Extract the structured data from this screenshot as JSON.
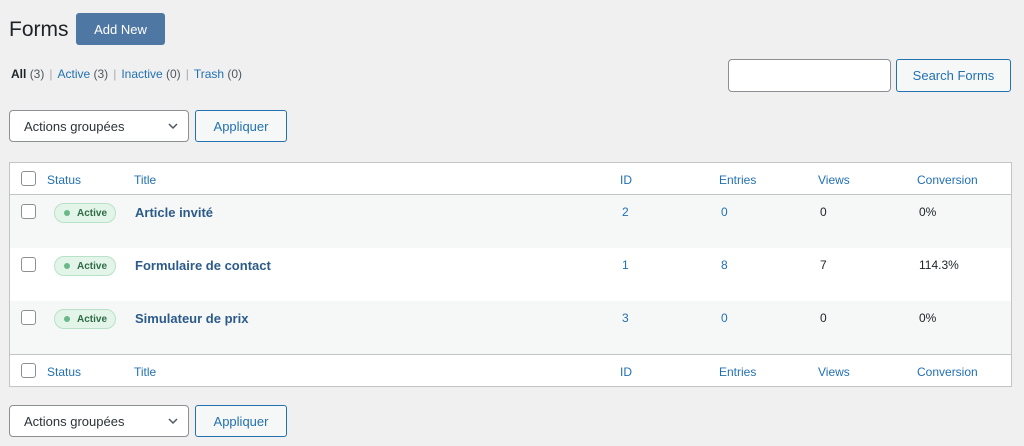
{
  "header": {
    "title": "Forms",
    "add_new_label": "Add New"
  },
  "filters": {
    "all_label": "All",
    "all_count": "(3)",
    "active_label": "Active",
    "active_count": "(3)",
    "inactive_label": "Inactive",
    "inactive_count": "(0)",
    "trash_label": "Trash",
    "trash_count": "(0)",
    "separator": "|"
  },
  "search": {
    "value": "",
    "button_label": "Search Forms"
  },
  "bulk_top": {
    "selected": "Actions groupées",
    "apply_label": "Appliquer"
  },
  "bulk_bottom": {
    "selected": "Actions groupées",
    "apply_label": "Appliquer"
  },
  "columns": {
    "status": "Status",
    "title": "Title",
    "id": "ID",
    "entries": "Entries",
    "views": "Views",
    "conversion": "Conversion"
  },
  "rows": [
    {
      "status": "Active",
      "title": "Article invité",
      "id": "2",
      "entries": "0",
      "views": "0",
      "conversion": "0%"
    },
    {
      "status": "Active",
      "title": "Formulaire de contact",
      "id": "1",
      "entries": "8",
      "views": "7",
      "conversion": "114.3%"
    },
    {
      "status": "Active",
      "title": "Simulateur de prix",
      "id": "3",
      "entries": "0",
      "views": "0",
      "conversion": "0%"
    }
  ],
  "colors": {
    "primary": "#2271b1",
    "add_new_bg": "#4f77a3",
    "active_badge_bg": "#e3f5e9"
  },
  "icons": {
    "select_arrow": "chevron-down-icon",
    "status_dot": "status-dot-icon"
  }
}
